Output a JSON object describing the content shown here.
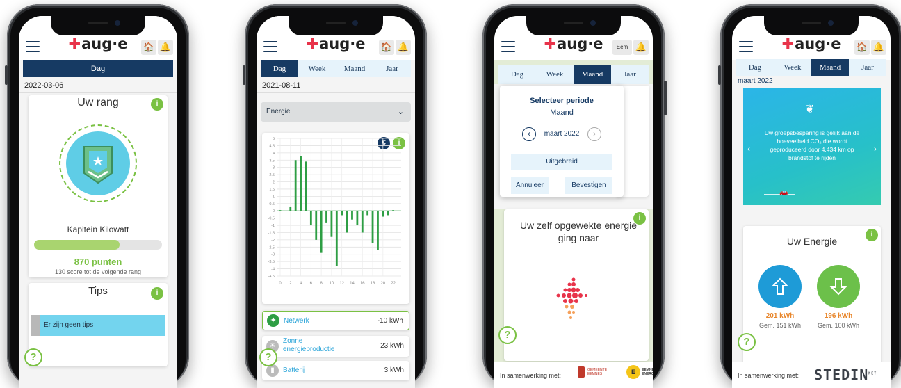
{
  "brand": {
    "logo_text": "aug·e",
    "accent": "#7ac143",
    "navy": "#163a63"
  },
  "phone1": {
    "tab_day": "Dag",
    "date": "2022-03-06",
    "rank_title": "Uw rang",
    "rank_name": "Kapitein Kilowatt",
    "progress": 0.67,
    "points": "870 punten",
    "next_rank": "130 score tot de volgende rang",
    "tips_title": "Tips",
    "tips_empty": "Er zijn geen tips",
    "info": "i",
    "help": "?"
  },
  "phone2": {
    "tabs": [
      "Dag",
      "Week",
      "Maand",
      "Jaar"
    ],
    "date": "2021-08-11",
    "select_value": "Energie",
    "euro": "€",
    "info": "i",
    "chart_data": {
      "type": "bar",
      "x": [
        0,
        1,
        2,
        3,
        4,
        5,
        6,
        7,
        8,
        9,
        10,
        11,
        12,
        13,
        14,
        15,
        16,
        17,
        18,
        19,
        20,
        21,
        22,
        23
      ],
      "values": [
        0.05,
        0,
        0.3,
        3.5,
        3.8,
        3.4,
        -1.0,
        -2.0,
        -2.9,
        -0.8,
        -1.8,
        -3.8,
        -0.3,
        -1.5,
        -0.6,
        -1.0,
        -1.5,
        -0.3,
        -2.2,
        -2.7,
        -0.4,
        -0.3,
        0.05,
        0
      ],
      "xticks": [
        "0",
        "2",
        "4",
        "6",
        "8",
        "10",
        "12",
        "14",
        "16",
        "18",
        "20",
        "22"
      ],
      "yticks": [
        "5",
        "4.5",
        "4",
        "3.5",
        "3",
        "2.5",
        "2",
        "1.5",
        "1",
        "0.5",
        "0",
        "-0.5",
        "-1",
        "-1.5",
        "-2",
        "-2.5",
        "-3",
        "-3.5",
        "-4",
        "-4.5"
      ],
      "ylim": [
        -4.5,
        5
      ],
      "grid": true,
      "color": "#2e9e44"
    },
    "items": [
      {
        "label": "Netwerk",
        "value": "-10 kWh"
      },
      {
        "label": "Zonne energieproductie",
        "value": "23 kWh"
      },
      {
        "label": "Batterij",
        "value": "3 kWh"
      }
    ],
    "help": "?"
  },
  "phone3": {
    "hdr_btn": "Eem",
    "tabs": [
      "Dag",
      "Week",
      "Maand",
      "Jaar"
    ],
    "popup_title": "Selecteer periode",
    "popup_period": "Maand",
    "popup_month": "maart 2022",
    "extended": "Uitgebreid",
    "cancel": "Annuleer",
    "confirm": "Bevestigen",
    "card_title": "Uw zelf opgewekte energie ging naar",
    "footer_text": "In samenwerking met:",
    "partner1": "GEMEENTE EEMNES",
    "partner2": "EEMNES ENERGIE",
    "info": "i",
    "help": "?"
  },
  "phone4": {
    "tabs": [
      "Dag",
      "Week",
      "Maand",
      "Jaar"
    ],
    "date": "maart 2022",
    "banner_text": "Uw groepsbesparing is gelijk aan de hoeveelheid CO₂ die wordt geproduceerd door 4.434 km op brandstof te rijden",
    "energy_title": "Uw Energie",
    "out_kwh": "201 kWh",
    "out_avg": "Gem. 151 kWh",
    "in_kwh": "196 kWh",
    "in_avg": "Gem. 100 kWh",
    "footer_text": "In samenwerking met:",
    "partner": "STEDIN",
    "partner_sup": "NET",
    "info": "i",
    "help": "?"
  }
}
